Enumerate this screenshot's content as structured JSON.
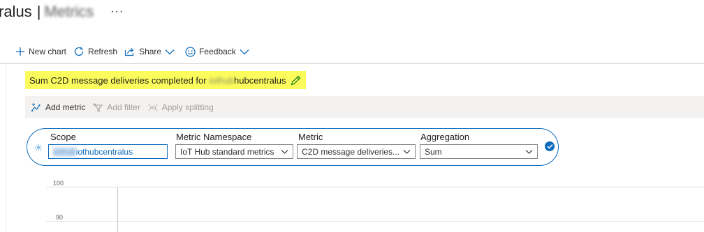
{
  "page": {
    "title_prefix": "ralus",
    "title_separator": "|",
    "title_blurred": "Metrics",
    "more_label": "···"
  },
  "toolbar": {
    "new_chart": "New chart",
    "refresh": "Refresh",
    "share": "Share",
    "feedback": "Feedback"
  },
  "chart": {
    "title_prefix": "Sum C2D message deliveries completed for",
    "title_resource_blurred": "iothub",
    "title_resource_suffix": "hubcentralus"
  },
  "metric_bar": {
    "add_metric": "Add metric",
    "add_filter": "Add filter",
    "apply_splitting": "Apply splitting"
  },
  "metric_row": {
    "scope_label": "Scope",
    "scope_blurred": "iothub",
    "scope_suffix": "iothubcentralus",
    "namespace_label": "Metric Namespace",
    "namespace_value": "IoT Hub standard metrics",
    "metric_label": "Metric",
    "metric_value": "C2D message deliveries...",
    "aggregation_label": "Aggregation",
    "aggregation_value": "Sum"
  },
  "y_axis": {
    "ticks": [
      "100",
      "90"
    ]
  },
  "colors": {
    "accent": "#0f6cbd",
    "highlight": "#fcfc5c",
    "command_bar": "#f3f2f1"
  }
}
